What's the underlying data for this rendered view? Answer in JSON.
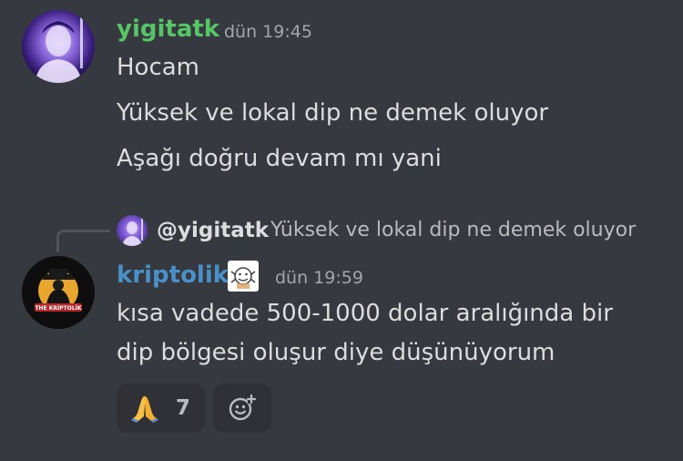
{
  "messages": [
    {
      "author": "yigitatk",
      "author_color": "#57c566",
      "timestamp": "dün 19:45",
      "lines": [
        "Hocam",
        "Yüksek ve lokal dip ne demek oluyor",
        "Aşağı doğru devam mı yani"
      ]
    },
    {
      "reply": {
        "mention": "@yigitatk",
        "text": "Yüksek ve lokal dip ne demek oluyor"
      },
      "author": "kriptolik",
      "author_color": "#4a90c8",
      "timestamp": "dün 19:59",
      "lines": [
        "kısa vadede 500-1000 dolar aralığında bir",
        "dip bölgesi oluşur diye düşünüyorum"
      ],
      "avatar_banner": "THE KRİPTOLİK",
      "reactions": [
        {
          "emoji": "🙏",
          "count": "7"
        }
      ]
    }
  ]
}
